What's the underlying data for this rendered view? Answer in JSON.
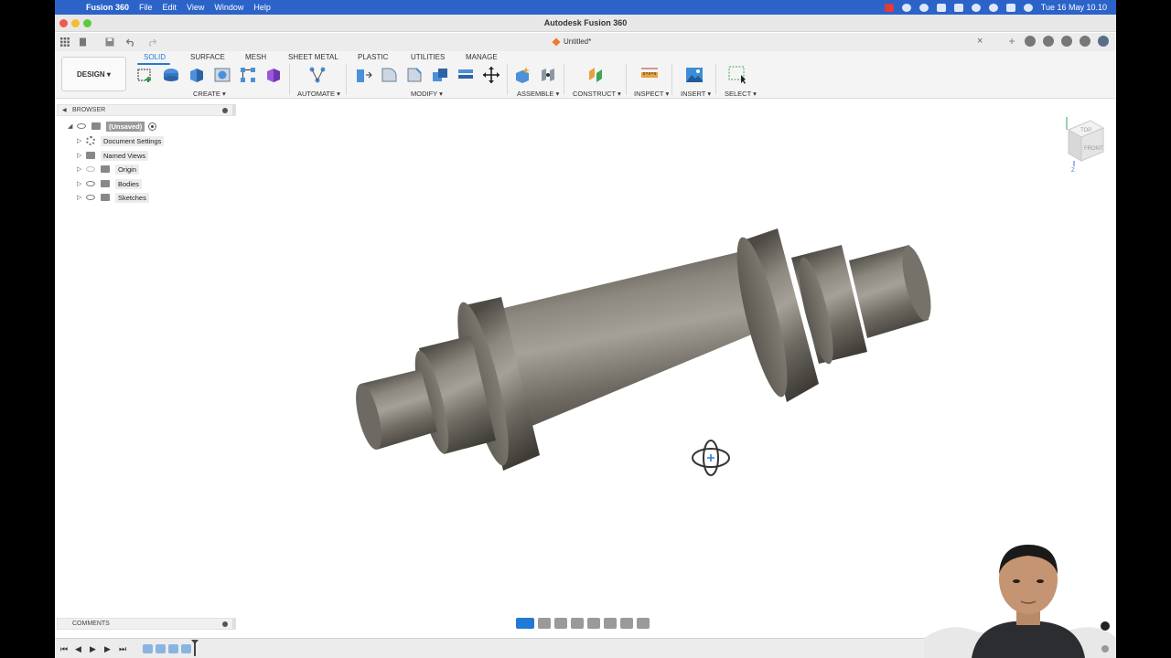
{
  "menubar": {
    "app_name": "Fusion 360",
    "items": [
      "File",
      "Edit",
      "View",
      "Window",
      "Help"
    ],
    "datetime": "Tue 16 May  10.10"
  },
  "window": {
    "title": "Autodesk Fusion 360"
  },
  "document": {
    "tab_title": "Untitled*"
  },
  "toolbar": {
    "workspace_button": "DESIGN",
    "tabs": [
      {
        "label": "SOLID",
        "active": true
      },
      {
        "label": "SURFACE"
      },
      {
        "label": "MESH"
      },
      {
        "label": "SHEET METAL"
      },
      {
        "label": "PLASTIC"
      },
      {
        "label": "UTILITIES"
      },
      {
        "label": "MANAGE"
      }
    ],
    "groups": {
      "create": "CREATE",
      "automate": "AUTOMATE",
      "modify": "MODIFY",
      "assemble": "ASSEMBLE",
      "construct": "CONSTRUCT",
      "inspect": "INSPECT",
      "insert": "INSERT",
      "select": "SELECT"
    }
  },
  "browser": {
    "header": "BROWSER",
    "root": "(Unsaved)",
    "items": [
      "Document Settings",
      "Named Views",
      "Origin",
      "Bodies",
      "Sketches"
    ]
  },
  "viewcube": {
    "top": "TOP",
    "front": "FRONT",
    "axis": "Z"
  },
  "comments": {
    "header": "COMMENTS"
  },
  "colors": {
    "menubar": "#2c63c9",
    "accent": "#1f7bd6",
    "shaft_body": "#6d6a63"
  }
}
